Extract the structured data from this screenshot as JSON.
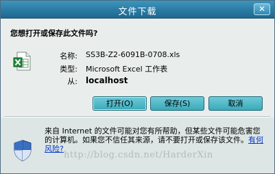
{
  "window": {
    "title": "文件下载",
    "close_label": "✕"
  },
  "dialog": {
    "question": "您想打开或保存此文件吗?",
    "fields": [
      {
        "label": "名称:",
        "value": "SS3B-Z2-6091B-0708.xls"
      },
      {
        "label": "类型:",
        "value": "Microsoft Excel 工作表"
      },
      {
        "label": "从:",
        "value": "localhost"
      }
    ]
  },
  "buttons": {
    "open": "打开(O)",
    "save": "保存(S)",
    "cancel": "取消"
  },
  "warning": {
    "text": "来自 Internet 的文件可能对您有所帮助，但某些文件可能危害您的计算机。如果您不信任其来源，请不要打开或保存该文件。",
    "link": "有何风险?"
  },
  "watermark": "http://blog.csdn.net/HarderXin",
  "icons": {
    "file": "excel-file-icon",
    "warning": "security-shield-icon"
  },
  "colors": {
    "titlebar": "#2b7aa3",
    "button": "#3aaab9",
    "link": "#0033cc"
  }
}
